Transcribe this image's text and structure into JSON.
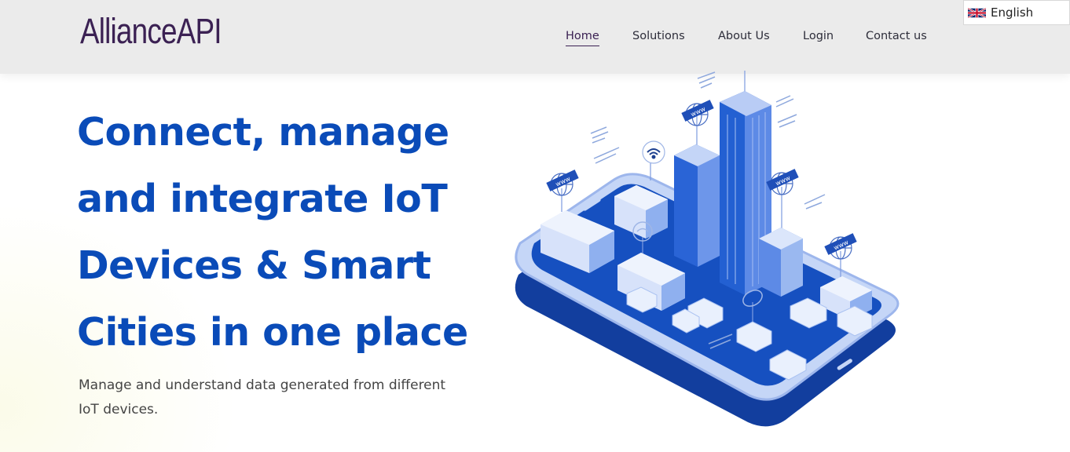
{
  "header": {
    "logo": "AllianceAPI",
    "nav": [
      {
        "label": "Home",
        "active": true
      },
      {
        "label": "Solutions",
        "active": false
      },
      {
        "label": "About Us",
        "active": false
      },
      {
        "label": "Login",
        "active": false
      },
      {
        "label": "Contact us",
        "active": false
      }
    ],
    "language": {
      "label": "English",
      "flag": "uk-flag-icon"
    }
  },
  "hero": {
    "title_lines": [
      "Connect, manage",
      "and integrate IoT",
      "Devices & Smart",
      "Cities in one place"
    ],
    "subtitle_line1": "Manage and understand data generated from different",
    "subtitle_line2": "IoT devices.",
    "illustration": "isometric-smart-city-on-phone",
    "web_sign_text": "www"
  },
  "colors": {
    "brand": "#3b2153",
    "hero_blue": "#0a4bb8",
    "nav_bg": "#ebebeb"
  }
}
